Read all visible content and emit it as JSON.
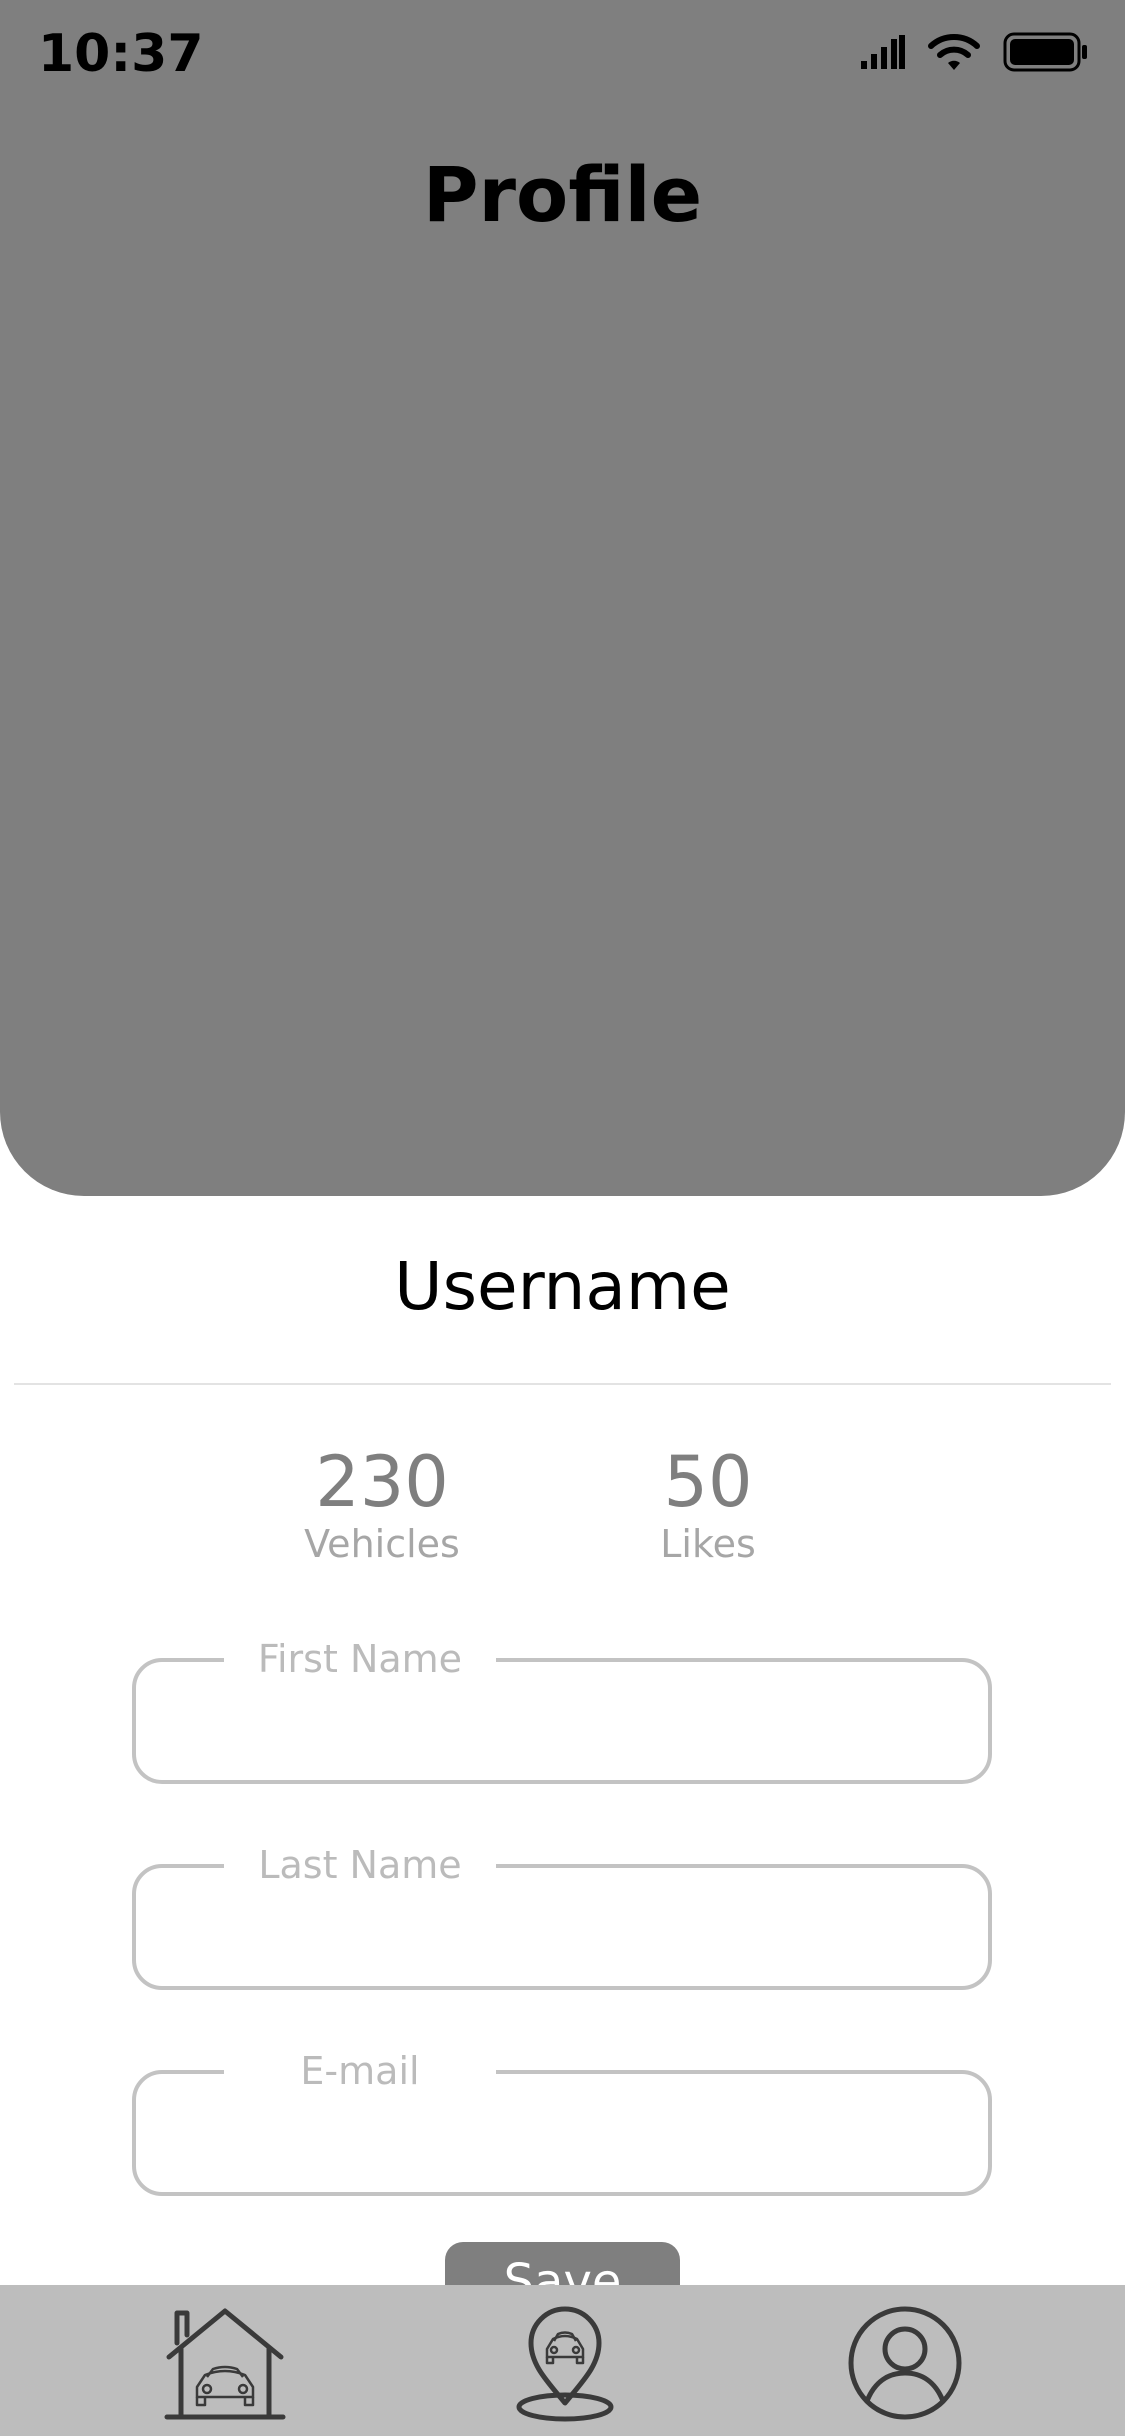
{
  "status_bar": {
    "time": "10:37",
    "icons": [
      "signal-icon",
      "wifi-icon",
      "battery-icon"
    ]
  },
  "header": {
    "title": "Profile"
  },
  "profile": {
    "username": "Username",
    "stats": [
      {
        "value": "230",
        "label": "Vehicles"
      },
      {
        "value": "50",
        "label": "Likes"
      }
    ]
  },
  "form": {
    "fields": [
      {
        "label": "First Name",
        "value": ""
      },
      {
        "label": "Last Name",
        "value": ""
      },
      {
        "label": "E-mail",
        "value": ""
      }
    ],
    "save_label": "Save"
  },
  "tab_bar": {
    "tabs": [
      {
        "icon": "garage-car-icon"
      },
      {
        "icon": "car-location-pin-icon"
      },
      {
        "icon": "user-profile-icon"
      }
    ]
  },
  "colors": {
    "header_bg": "#7f7f7f",
    "tab_bar_bg": "#bdbdbd",
    "stat_value": "#7f7f7f",
    "field_border": "#c3c3c3",
    "save_button_bg": "#7f7f7f"
  }
}
